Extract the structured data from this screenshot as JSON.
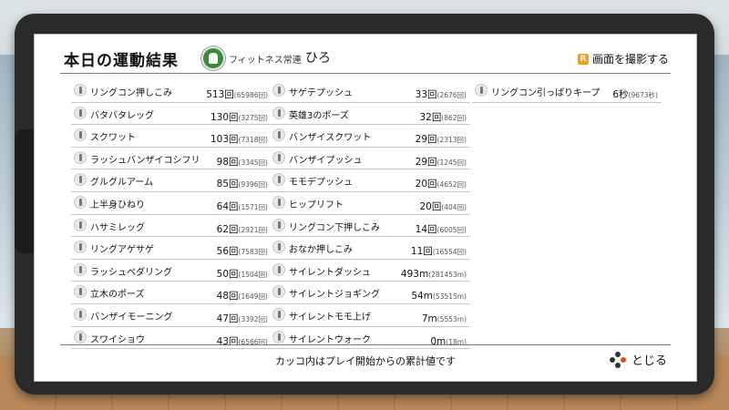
{
  "header": {
    "title": "本日の運動結果",
    "user_title": "フィットネス常連",
    "user_name": "ひろ",
    "capture_button_key": "R",
    "capture_label": "画面を撮影する"
  },
  "columns": [
    [
      {
        "name": "リングコン押しこみ",
        "value": "513回",
        "total": "(65986回)"
      },
      {
        "name": "バタバタレッグ",
        "value": "130回",
        "total": "(3275回)"
      },
      {
        "name": "スクワット",
        "value": "103回",
        "total": "(7318回)"
      },
      {
        "name": "ラッシュバンザイコシフリ",
        "value": "98回",
        "total": "(3345回)"
      },
      {
        "name": "グルグルアーム",
        "value": "85回",
        "total": "(9396回)"
      },
      {
        "name": "上半身ひねり",
        "value": "64回",
        "total": "(1571回)"
      },
      {
        "name": "ハサミレッグ",
        "value": "62回",
        "total": "(2921回)"
      },
      {
        "name": "リングアゲサゲ",
        "value": "56回",
        "total": "(7583回)"
      },
      {
        "name": "ラッシュペダリング",
        "value": "50回",
        "total": "(1504回)"
      },
      {
        "name": "立木のポーズ",
        "value": "48回",
        "total": "(1649回)"
      },
      {
        "name": "バンザイモーニング",
        "value": "47回",
        "total": "(3392回)"
      },
      {
        "name": "スワイショウ",
        "value": "43回",
        "total": "(6566回)"
      }
    ],
    [
      {
        "name": "サゲテプッシュ",
        "value": "33回",
        "total": "(2676回)"
      },
      {
        "name": "英雄3のポーズ",
        "value": "32回",
        "total": "(862回)"
      },
      {
        "name": "バンザイスクワット",
        "value": "29回",
        "total": "(2313回)"
      },
      {
        "name": "バンザイプッシュ",
        "value": "29回",
        "total": "(1245回)"
      },
      {
        "name": "モモデプッシュ",
        "value": "20回",
        "total": "(4652回)"
      },
      {
        "name": "ヒップリフト",
        "value": "20回",
        "total": "(404回)"
      },
      {
        "name": "リングコン下押しこみ",
        "value": "14回",
        "total": "(6005回)"
      },
      {
        "name": "おなか押しこみ",
        "value": "11回",
        "total": "(16554回)"
      },
      {
        "name": "サイレントダッシュ",
        "value": "493m",
        "total": "(281453m)"
      },
      {
        "name": "サイレントジョギング",
        "value": "54m",
        "total": "(53515m)"
      },
      {
        "name": "サイレントモモ上げ",
        "value": "7m",
        "total": "(5553m)"
      },
      {
        "name": "サイレントウォーク",
        "value": "0m",
        "total": "(18m)"
      }
    ],
    [
      {
        "name": "リングコン引っぱりキープ",
        "value": "6秒",
        "total": "(9673秒)"
      }
    ]
  ],
  "footer": {
    "note": "カッコ内はプレイ開始からの累計値です",
    "close_label": "とじる"
  }
}
